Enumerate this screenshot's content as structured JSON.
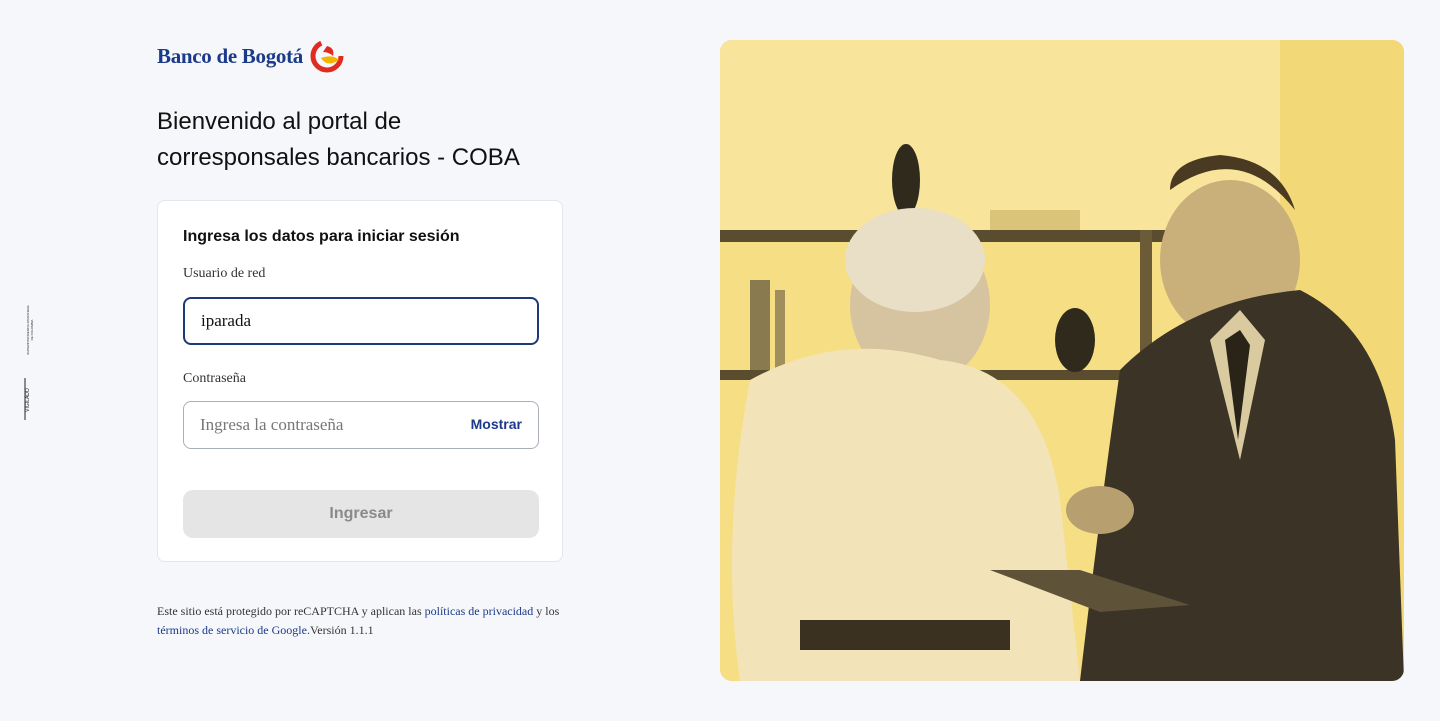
{
  "brand": {
    "name": "Banco de Bogotá",
    "accent": "#1c3a8a",
    "logo_colors": [
      "#e02b20",
      "#f4b400"
    ]
  },
  "vigilado": {
    "text": "VIGILADO",
    "subtext": "SUPERINTENDENCIA FINANCIERA DE COLOMBIA"
  },
  "welcome": {
    "line1": "Bienvenido al portal de",
    "line2": "corresponsales bancarios - COBA"
  },
  "login": {
    "title": "Ingresa los datos para iniciar sesión",
    "user_label": "Usuario de red",
    "user_value": "iparada",
    "password_label": "Contraseña",
    "password_placeholder": "Ingresa la contraseña",
    "show_label": "Mostrar",
    "submit_label": "Ingresar"
  },
  "legal": {
    "part1": "Este sitio está protegido por reCAPTCHA y aplican las ",
    "privacy_link": "políticas de privacidad",
    "part2": " y los ",
    "terms_link": "términos de servicio de Google.",
    "version": "Versión 1.1.1"
  },
  "hero": {
    "tint": "#f4da7a",
    "description_icon": "handshake-photo"
  }
}
